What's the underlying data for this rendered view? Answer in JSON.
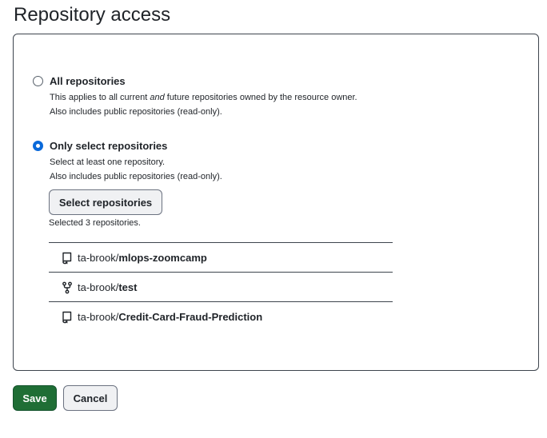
{
  "page": {
    "title": "Repository access"
  },
  "options": {
    "all": {
      "label": "All repositories",
      "desc_prefix": "This applies to all current ",
      "desc_em": "and",
      "desc_suffix": " future repositories owned by the resource owner.",
      "desc_2": "Also includes public repositories (read-only).",
      "checked": false
    },
    "select": {
      "label": "Only select repositories",
      "desc_1": "Select at least one repository.",
      "desc_2": "Also includes public repositories (read-only).",
      "checked": true
    }
  },
  "select_button": {
    "label": "Select repositories"
  },
  "selected_count": "Selected 3 repositories.",
  "repos": [
    {
      "owner": "ta-brook/",
      "name": "mlops-zoomcamp",
      "icon": "repo-icon"
    },
    {
      "owner": "ta-brook/",
      "name": "test",
      "icon": "repo-forked-icon"
    },
    {
      "owner": "ta-brook/",
      "name": "Credit-Card-Fraud-Prediction",
      "icon": "repo-icon"
    }
  ],
  "actions": {
    "save_label": "Save",
    "cancel_label": "Cancel"
  },
  "colors": {
    "accent": "#0969da",
    "save": "#1f6e35",
    "border": "#3d444d"
  }
}
